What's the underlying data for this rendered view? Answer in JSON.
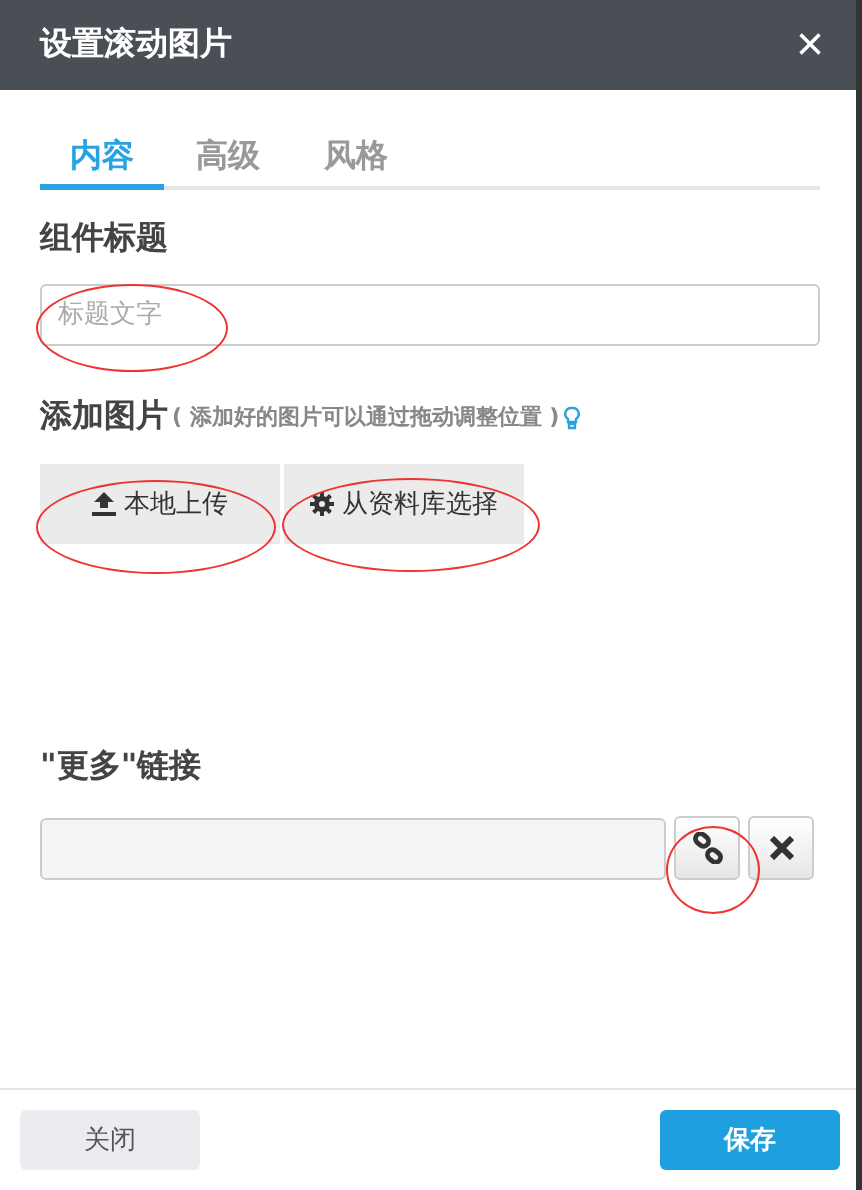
{
  "dialog": {
    "title": "设置滚动图片",
    "close_label": "×"
  },
  "tabs": [
    {
      "label": "内容",
      "selected": true
    },
    {
      "label": "高级",
      "selected": false
    },
    {
      "label": "风格",
      "selected": false
    }
  ],
  "title_section": {
    "label": "组件标题",
    "placeholder": "标题文字"
  },
  "image_section": {
    "label": "添加图片",
    "hint": "( 添加好的图片可以通过拖动调整位置 )",
    "buttons": [
      {
        "label": "本地上传",
        "kind": "upload"
      },
      {
        "label": "从资料库选择",
        "kind": "library"
      }
    ]
  },
  "more_link": {
    "label": "\"更多\"链接"
  },
  "footer": {
    "close": "关闭",
    "save": "保存"
  }
}
